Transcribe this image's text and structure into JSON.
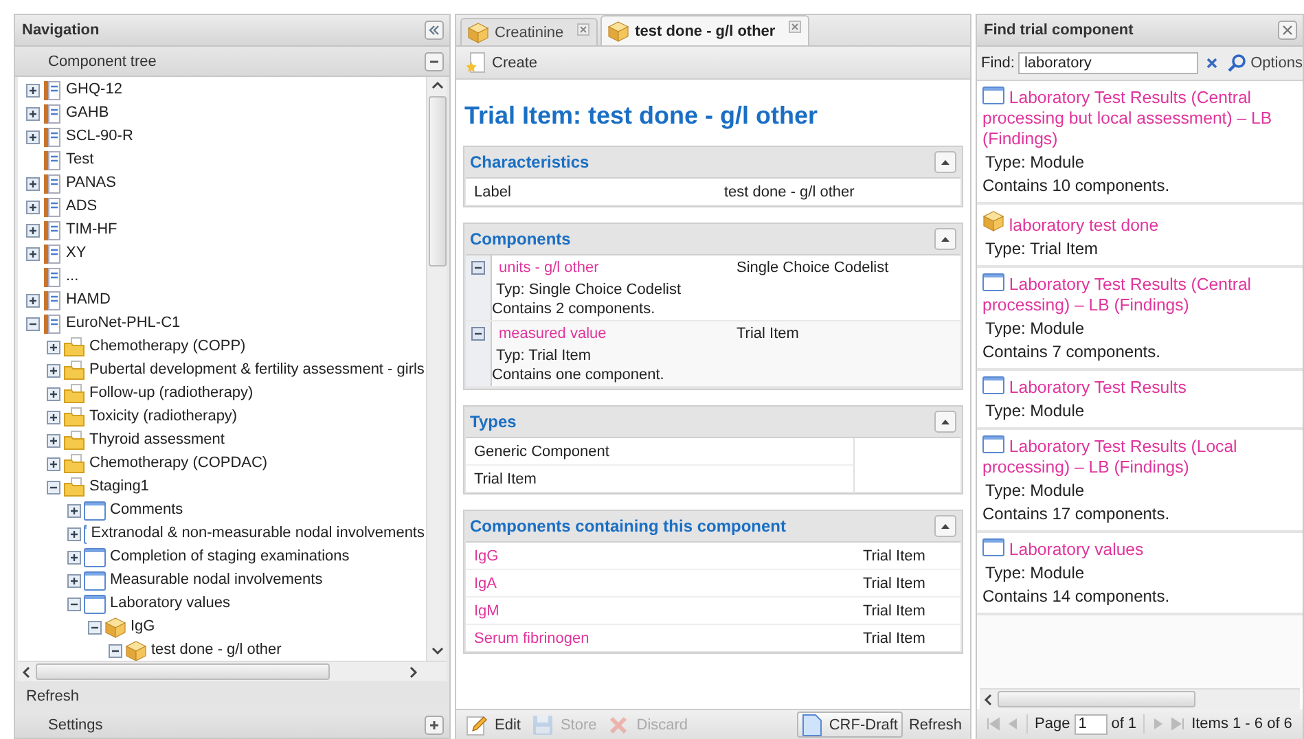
{
  "navigation": {
    "title": "Navigation",
    "tree_title": "Component tree",
    "tree": [
      {
        "label": "GHQ-12",
        "kind": "form",
        "has_children": true,
        "expanded": false
      },
      {
        "label": "GAHB",
        "kind": "form",
        "has_children": true,
        "expanded": false
      },
      {
        "label": "SCL-90-R",
        "kind": "form",
        "has_children": true,
        "expanded": false
      },
      {
        "label": "Test",
        "kind": "form",
        "has_children": false
      },
      {
        "label": "PANAS",
        "kind": "form",
        "has_children": true,
        "expanded": false
      },
      {
        "label": "ADS",
        "kind": "form",
        "has_children": true,
        "expanded": false
      },
      {
        "label": "TIM-HF",
        "kind": "form",
        "has_children": true,
        "expanded": false
      },
      {
        "label": "XY",
        "kind": "form",
        "has_children": true,
        "expanded": false
      },
      {
        "label": "...",
        "kind": "form",
        "has_children": false
      },
      {
        "label": "HAMD",
        "kind": "form",
        "has_children": true,
        "expanded": false
      },
      {
        "label": "EuroNet-PHL-C1",
        "kind": "form",
        "has_children": true,
        "expanded": true,
        "children": [
          {
            "label": "Chemotherapy (COPP)",
            "kind": "folder",
            "has_children": true,
            "expanded": false
          },
          {
            "label": "Pubertal development & fertility assessment - girls",
            "kind": "folder",
            "has_children": true,
            "expanded": false
          },
          {
            "label": "Follow-up (radiotherapy)",
            "kind": "folder",
            "has_children": true,
            "expanded": false
          },
          {
            "label": "Toxicity (radiotherapy)",
            "kind": "folder",
            "has_children": true,
            "expanded": false
          },
          {
            "label": "Thyroid assessment",
            "kind": "folder",
            "has_children": true,
            "expanded": false
          },
          {
            "label": "Chemotherapy (COPDAC)",
            "kind": "folder",
            "has_children": true,
            "expanded": false
          },
          {
            "label": "Staging1",
            "kind": "folder",
            "has_children": true,
            "expanded": true,
            "children": [
              {
                "label": "Comments",
                "kind": "module",
                "has_children": true,
                "expanded": false
              },
              {
                "label": "Extranodal & non-measurable nodal involvements",
                "kind": "module",
                "has_children": true,
                "expanded": false
              },
              {
                "label": "Completion of staging examinations",
                "kind": "module",
                "has_children": true,
                "expanded": false
              },
              {
                "label": "Measurable nodal involvements",
                "kind": "module",
                "has_children": true,
                "expanded": false
              },
              {
                "label": "Laboratory values",
                "kind": "module",
                "has_children": true,
                "expanded": true,
                "children": [
                  {
                    "label": "IgG",
                    "kind": "item",
                    "has_children": true,
                    "expanded": true,
                    "children": [
                      {
                        "label": "test done - g/l other",
                        "kind": "item",
                        "has_children": true,
                        "expanded": true
                      }
                    ]
                  }
                ]
              }
            ]
          }
        ]
      }
    ],
    "refresh": "Refresh",
    "settings": "Settings"
  },
  "editor": {
    "tabs": [
      {
        "label": "Creatinine",
        "selected": false
      },
      {
        "label": "test done - g/l other",
        "selected": true
      }
    ],
    "create": "Create",
    "title": "Trial Item: test done - g/l other",
    "sections": [
      {
        "kind": "properties",
        "title": "Characteristics",
        "rows": [
          {
            "label": "Label",
            "value": "test done - g/l other"
          }
        ]
      },
      {
        "kind": "components",
        "title": "Components",
        "rows": [
          {
            "name": "units - g/l other",
            "type": "Single Choice Codelist",
            "detail": "Typ: Single Choice Codelist",
            "contains": "Contains 2 components.",
            "expanded": true
          },
          {
            "name": "measured value",
            "type": "Trial Item",
            "detail": "Typ: Trial Item",
            "contains": "Contains one component.",
            "expanded": true
          }
        ]
      },
      {
        "kind": "list",
        "title": "Types",
        "rows": [
          {
            "name": "Generic Component"
          },
          {
            "name": "Trial Item"
          }
        ]
      },
      {
        "kind": "links",
        "title": "Components containing this component",
        "rows": [
          {
            "name": "IgG",
            "type": "Trial Item"
          },
          {
            "name": "IgA",
            "type": "Trial Item"
          },
          {
            "name": "IgM",
            "type": "Trial Item"
          },
          {
            "name": "Serum fibrinogen",
            "type": "Trial Item"
          }
        ]
      }
    ],
    "actions": [
      {
        "kind": "edit",
        "label": "Edit",
        "disabled": false
      },
      {
        "kind": "store",
        "label": "Store",
        "disabled": true
      },
      {
        "kind": "discard",
        "label": "Discard",
        "disabled": true
      }
    ],
    "crf": "CRF-Draft",
    "refresh": "Refresh"
  },
  "search": {
    "title": "Find trial component",
    "find_label": "Find:",
    "query": "laboratory",
    "options": "Options",
    "results": [
      {
        "kind": "module",
        "title": "Laboratory Test Results (Central processing but local assessment) – LB (Findings)",
        "type": "Type: Module",
        "contains": "Contains 10 components."
      },
      {
        "kind": "item",
        "title": "laboratory test done",
        "type": "Type: Trial Item"
      },
      {
        "kind": "module",
        "title": "Laboratory Test Results (Central processing) – LB (Findings)",
        "type": "Type: Module",
        "contains": "Contains 7 components."
      },
      {
        "kind": "module",
        "title": "Laboratory Test Results",
        "type": "Type: Module"
      },
      {
        "kind": "module",
        "title": "Laboratory Test Results (Local processing) – LB (Findings)",
        "type": "Type: Module",
        "contains": "Contains 17 components."
      },
      {
        "kind": "module",
        "title": "Laboratory values",
        "type": "Type: Module",
        "contains": "Contains 14 components."
      }
    ],
    "pager": {
      "page_label": "Page",
      "page": "1",
      "of": "of 1",
      "items": "Items 1 - 6 of 6"
    }
  }
}
